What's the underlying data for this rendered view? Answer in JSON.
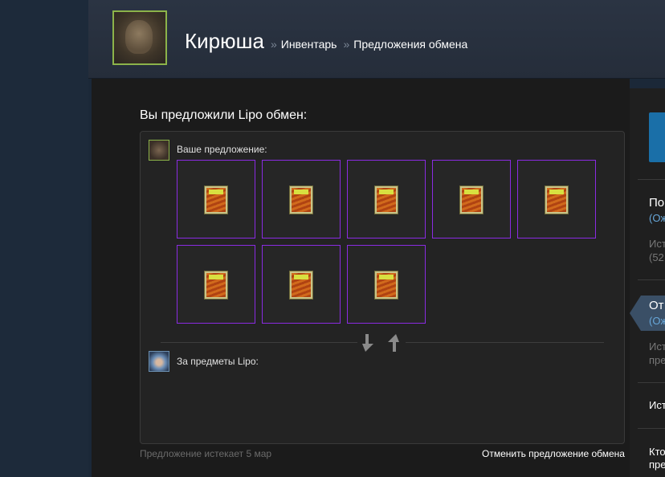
{
  "header": {
    "user_name": "Кирюша",
    "separator": "»",
    "breadcrumb_inventory": "Инвентарь",
    "breadcrumb_offers": "Предложения обмена"
  },
  "offer": {
    "title": "Вы предложили Lipo обмен:",
    "your_offer_label": "Ваше предложение:",
    "their_items_label": "За предметы Lipo:",
    "your_items_count": 8,
    "their_items_count": 0,
    "item_border_color": "#8a2be2",
    "expires_text": "Предложение истекает 5 мар",
    "cancel_label": "Отменить предложение обмена"
  },
  "sidebar": {
    "item1_title": "По",
    "item1_sub": "(Ож",
    "item1_gray1": "Ист",
    "item1_gray2": "(52",
    "item2_title": "От",
    "item2_sub": "(Ож",
    "item2_gray1": "Ист",
    "item2_gray2": "пре",
    "item3_title": "Ист",
    "item4_title": "Кто",
    "item4_title2": "пре"
  },
  "colors": {
    "accent_blue": "#1a6fa8",
    "link_blue": "#67a7d9",
    "avatar_border": "#8cb34a"
  }
}
